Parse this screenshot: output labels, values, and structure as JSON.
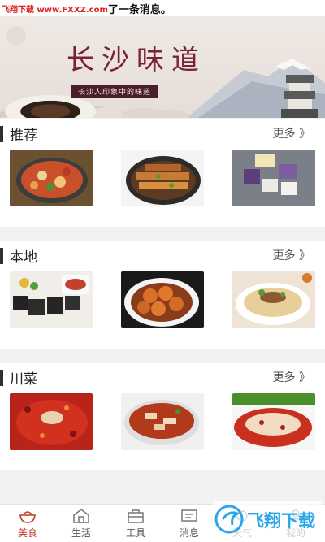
{
  "status_bar": {
    "watermark": "飞翔下载 www.FXXZ.com",
    "message": "了一条消息。"
  },
  "banner": {
    "title": "长沙味道",
    "subtitle": "长沙人印象中的味道"
  },
  "sections": [
    {
      "title": "推荐",
      "more": "更多 》",
      "images": [
        "hotpot-icon",
        "skewers-icon",
        "rice-cakes-icon"
      ]
    },
    {
      "title": "本地",
      "more": "更多 》",
      "images": [
        "stinky-tofu-icon",
        "meatballs-icon",
        "noodles-icon"
      ]
    },
    {
      "title": "川菜",
      "more": "更多 》",
      "images": [
        "spicy-chicken-icon",
        "boiled-fish-icon",
        "saliva-chicken-icon"
      ]
    }
  ],
  "tabbar": {
    "items": [
      {
        "label": "美食",
        "icon": "bowl-icon",
        "active": true
      },
      {
        "label": "生活",
        "icon": "house-icon",
        "active": false
      },
      {
        "label": "工具",
        "icon": "toolbox-icon",
        "active": false
      },
      {
        "label": "消息",
        "icon": "message-icon",
        "active": false
      },
      {
        "label": "天气",
        "icon": "weather-icon",
        "active": false
      },
      {
        "label": "我的",
        "icon": "profile-icon",
        "active": false
      }
    ]
  },
  "watermark_logo": {
    "text": "飞翔下载",
    "brand_color": "#2aa7e8"
  },
  "colors": {
    "accent": "#c0392b",
    "banner_title": "#7a2334",
    "banner_subtitle_bg": "#4a1f29"
  }
}
